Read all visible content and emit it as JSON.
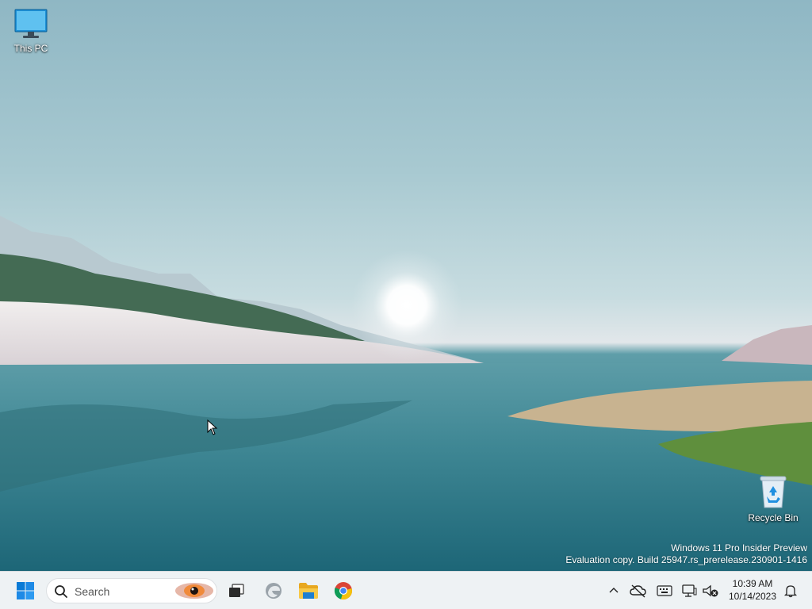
{
  "desktop": {
    "icons": [
      {
        "label": "This PC",
        "icon": "monitor-icon"
      },
      {
        "label": "Recycle Bin",
        "icon": "recycle-bin-icon"
      }
    ],
    "watermark": {
      "line1": "Windows 11 Pro Insider Preview",
      "line2": "Evaluation copy. Build 25947.rs_prerelease.230901-1416"
    }
  },
  "taskbar": {
    "search": {
      "placeholder": "Search"
    },
    "pinned": [
      {
        "name": "Task View",
        "icon": "task-view-icon"
      },
      {
        "name": "Microsoft Edge",
        "icon": "edge-icon"
      },
      {
        "name": "File Explorer",
        "icon": "folder-icon"
      },
      {
        "name": "Google Chrome",
        "icon": "chrome-icon"
      }
    ],
    "clock": {
      "time": "10:39 AM",
      "date": "10/14/2023"
    }
  },
  "colors": {
    "start_blue": "#0078d4",
    "taskbar_bg": "#eef2f4",
    "folder_yellow": "#f7c948"
  }
}
